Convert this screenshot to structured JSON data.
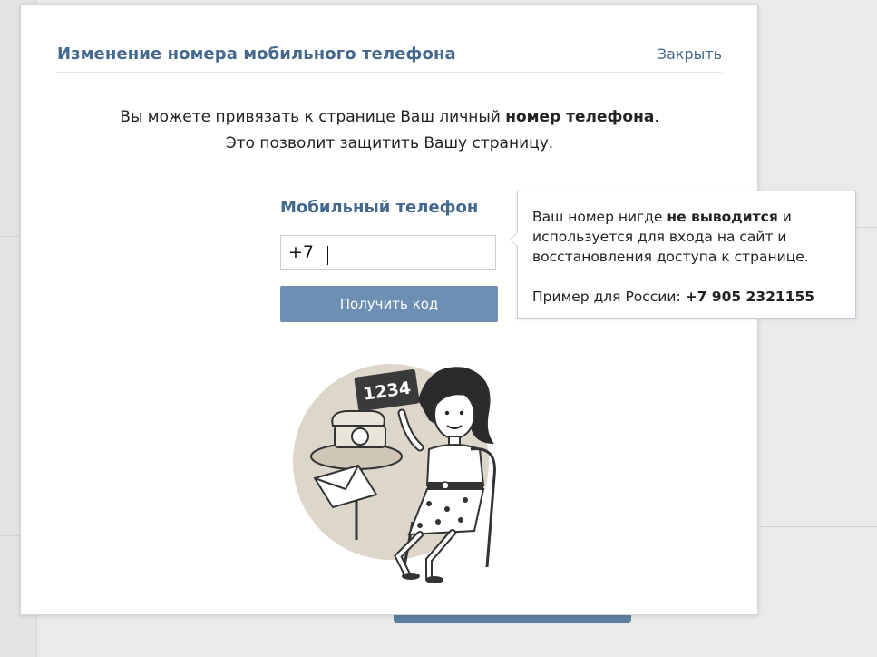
{
  "dialog": {
    "title": "Изменение номера мобильного телефона",
    "close_label": "Закрыть",
    "intro_line1_pre": "Вы можете привязать к странице Ваш личный ",
    "intro_line1_bold": "номер телефона",
    "intro_line1_post": ".",
    "intro_line2": "Это позволит защитить Вашу страницу."
  },
  "phone": {
    "label": "Мобильный телефон",
    "value": "+7",
    "button_label": "Получить код"
  },
  "tooltip": {
    "line1_pre": "Ваш номер нигде ",
    "line1_bold": "не выводится",
    "line1_post": " и используется для входа на сайт и восстановления доступа к странице.",
    "example_pre": "Пример для России: ",
    "example_bold": "+7 905 2321155"
  },
  "illustration": {
    "sign_text": "1234",
    "icon": "woman-with-phone-illustration"
  },
  "colors": {
    "accent": "#45688e",
    "button": "#6d8fb3",
    "overlay_bg": "#eaeaea"
  }
}
